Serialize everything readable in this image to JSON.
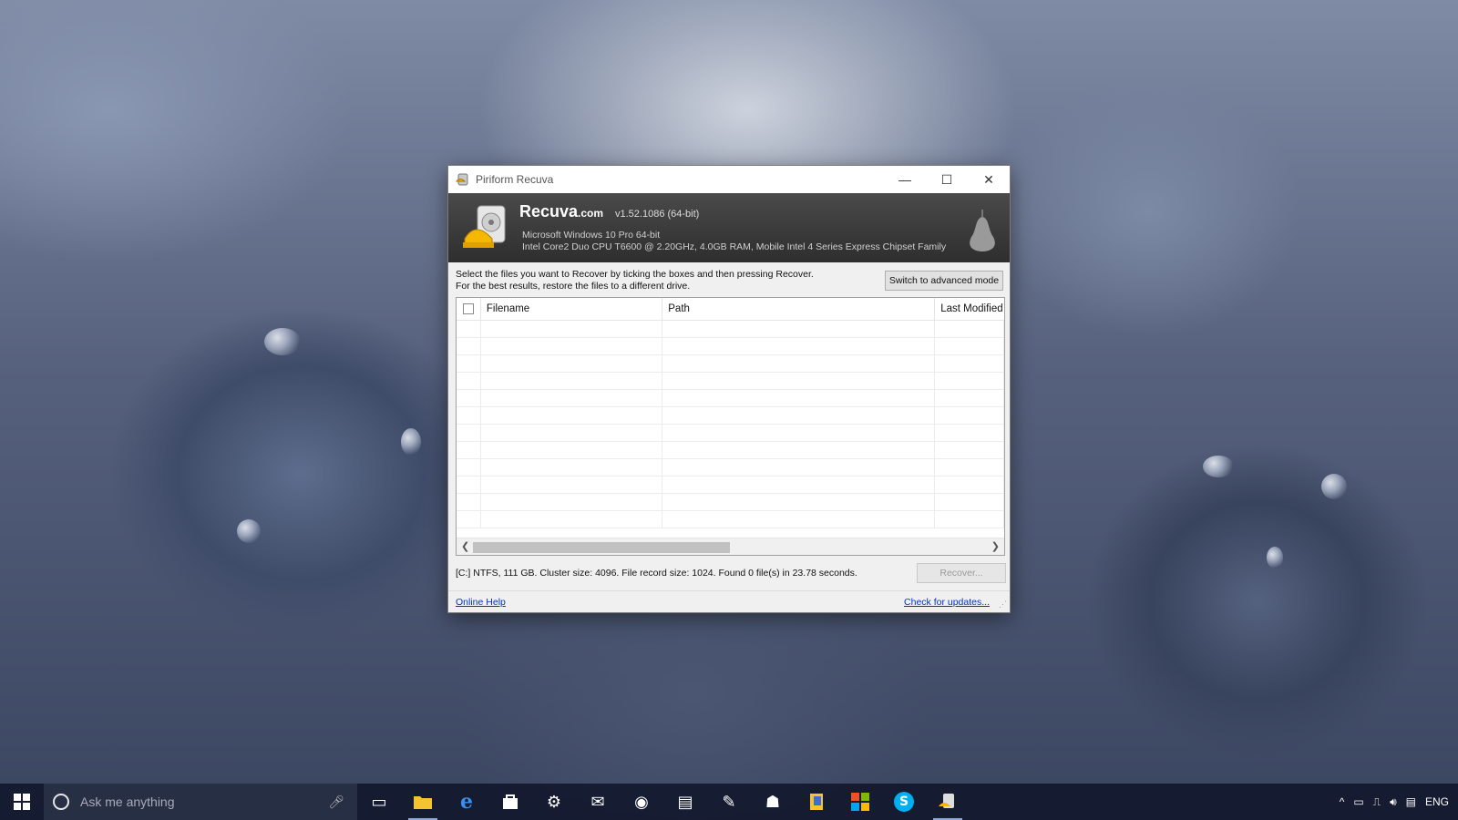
{
  "window": {
    "title": "Piriform Recuva",
    "controls": {
      "minimize": "—",
      "maximize": "☐",
      "close": "✕"
    }
  },
  "header": {
    "brand": "Recuva",
    "brand_suffix": ".com",
    "version": "v1.52.1086 (64-bit)",
    "os_line": "Microsoft Windows 10 Pro 64-bit",
    "hw_line": "Intel Core2 Duo CPU T6600 @ 2.20GHz, 4.0GB RAM, Mobile Intel 4 Series Express Chipset Family"
  },
  "instructions": {
    "line1": "Select the files you want to Recover by ticking the boxes and then pressing Recover.",
    "line2": "For the best results, restore the files to a different drive."
  },
  "advanced_button": "Switch to advanced mode",
  "table": {
    "columns": [
      "Filename",
      "Path",
      "Last Modified"
    ],
    "rows": []
  },
  "status_text": "[C:] NTFS, 111 GB. Cluster size: 4096. File record size: 1024. Found 0 file(s) in 23.78 seconds.",
  "recover_button": "Recover...",
  "footer": {
    "online_help": "Online Help",
    "check_updates": "Check for updates..."
  },
  "taskbar": {
    "search_placeholder": "Ask me anything",
    "apps": [
      "task-view-icon",
      "file-explorer-icon",
      "edge-icon",
      "store-icon",
      "settings-icon",
      "mail-icon",
      "camera-icon",
      "movies-icon",
      "paint-icon",
      "people-icon",
      "sticky-notes-icon",
      "windows-store-icon",
      "skype-icon",
      "recuva-icon"
    ],
    "tray_language": "ENG"
  },
  "colors": {
    "header_bg": "#2e2e2e",
    "taskbar_bg": "#12182c",
    "link": "#0033cc"
  }
}
